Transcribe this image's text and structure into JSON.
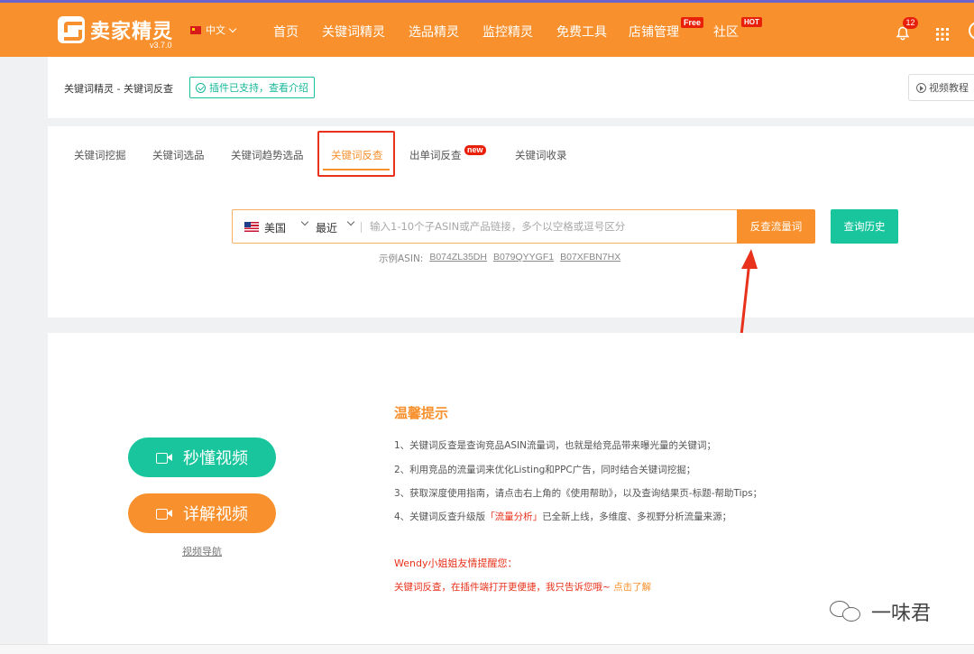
{
  "header": {
    "logo_text": "卖家精灵",
    "version": "v3.7.0",
    "language": "中文",
    "nav": [
      {
        "label": "首页"
      },
      {
        "label": "关键词精灵"
      },
      {
        "label": "选品精灵"
      },
      {
        "label": "监控精灵"
      },
      {
        "label": "免费工具"
      },
      {
        "label": "店铺管理",
        "badge": "Free"
      },
      {
        "label": "社区",
        "badge": "HOT"
      }
    ],
    "notification_count": "12"
  },
  "breadcrumb": {
    "path": "关键词精灵 - 关键词反查",
    "plugin_notice": "插件已支持，查看介绍",
    "video_tutorial": "视频教程"
  },
  "tabs": [
    {
      "label": "关键词挖掘"
    },
    {
      "label": "关键词选品"
    },
    {
      "label": "关键词趋势选品"
    },
    {
      "label": "关键词反查",
      "active": true
    },
    {
      "label": "出单词反查",
      "badge": "new"
    },
    {
      "label": "关键词收录"
    }
  ],
  "search": {
    "country": "美国",
    "period": "最近",
    "placeholder": "输入1-10个子ASIN或产品链接，多个以空格或逗号区分",
    "submit_label": "反查流量词",
    "history_label": "查询历史",
    "examples_label": "示例ASIN:",
    "examples": [
      "B074ZL35DH",
      "B079QYYGF1",
      "B07XFBN7HX"
    ]
  },
  "videos": {
    "quick_label": "秒懂视频",
    "detail_label": "详解视频",
    "nav_label": "视频导航"
  },
  "tips": {
    "title": "温馨提示",
    "items": [
      "1、关键词反查是查询竞品ASIN流量词，也就是给竞品带来曝光量的关键词；",
      "2、利用竞品的流量词来优化Listing和PPC广告，同时结合关键词挖掘；",
      "3、获取深度使用指南，请点击右上角的《使用帮助》，以及查询结果页-标题-帮助Tips；"
    ],
    "item4_prefix": "4、关键词反查升级版",
    "item4_highlight": "「流量分析」",
    "item4_suffix": "已全新上线，多维度、多视野分析流量来源；",
    "wendy_title": "Wendy小姐姐友情提醒您：",
    "wendy_message": "关键词反查，在插件端打开更便捷，我只告诉您哦~ ",
    "wendy_link": "点击了解"
  },
  "watermark": "一味君",
  "colors": {
    "brand_orange": "#f8912d",
    "accent_green": "#18c59c",
    "highlight_red": "#e8321b"
  }
}
